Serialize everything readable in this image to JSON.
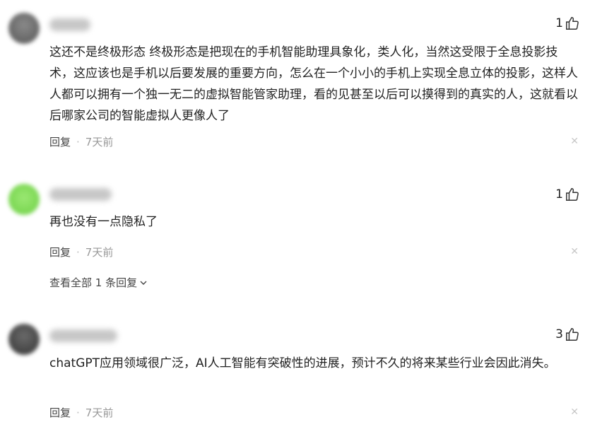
{
  "comments": [
    {
      "likes": "1",
      "text": "这还不是终极形态 终极形态是把现在的手机智能助理具象化，类人化，当然这受限于全息投影技术，这应该也是手机以后要发展的重要方向，怎么在一个小小的手机上实现全息立体的投影，这样人人都可以拥有一个独一无二的虚拟智能管家助理，看的见甚至以后可以摸得到的真实的人，这就看以后哪家公司的智能虚拟人更像人了",
      "reply_label": "回复",
      "separator": "·",
      "time": "7天前"
    },
    {
      "likes": "1",
      "text": "再也没有一点隐私了",
      "reply_label": "回复",
      "separator": "·",
      "time": "7天前",
      "view_all": "查看全部 1 条回复"
    },
    {
      "likes": "3",
      "text": "chatGPT应用领域很广泛，AI人工智能有突破性的进展，预计不久的将来某些行业会因此消失。",
      "reply_label": "回复",
      "separator": "·",
      "time": "7天前"
    }
  ],
  "icons": {
    "like": "thumbs-up-icon",
    "close": "close-icon",
    "chevron": "chevron-down-icon"
  },
  "colors": {
    "avatar1": "#6e6e6e",
    "avatar2": "#7ed957",
    "avatar3": "#4a4a4a",
    "name_blur": "#9a9a9a"
  }
}
